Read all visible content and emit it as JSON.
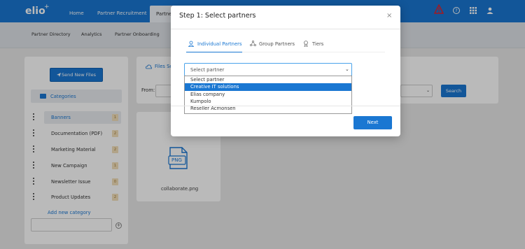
{
  "app": {
    "logo": "elio",
    "logo_plus": "+"
  },
  "top_nav": {
    "home": "Home",
    "partner_recruitment": "Partner Recruitment",
    "partner_active": "Partne"
  },
  "sub_nav": {
    "directory": "Partner Directory",
    "analytics": "Analytics",
    "onboarding": "Partner Onboarding"
  },
  "sidebar": {
    "send_button": "Send New Files",
    "categories_title": "Categories",
    "items": [
      {
        "label": "Banners",
        "count": "1"
      },
      {
        "label": "Documentation (PDF)",
        "count": "2"
      },
      {
        "label": "Marketing Material",
        "count": "2"
      },
      {
        "label": "New Campaign",
        "count": "1"
      },
      {
        "label": "Newsletter Issue",
        "count": "0"
      },
      {
        "label": "Product Updates",
        "count": "2"
      }
    ],
    "add_category": "Add new category"
  },
  "filter": {
    "files_tab": "Files Se",
    "from_label": "From:",
    "search_button": "Search"
  },
  "file": {
    "name": "collaborate.png",
    "icon_text": "PNG"
  },
  "modal": {
    "title": "Step 1: Select partners",
    "tabs": [
      {
        "label": "Individual Partners"
      },
      {
        "label": "Group Partners"
      },
      {
        "label": "Tiers"
      }
    ],
    "select_value": "Select partner",
    "options": [
      "Select partner",
      "Creative IT solutions",
      "Elias company",
      "Kumpolo",
      "Reseller Acmonsen"
    ],
    "highlighted_option_index": 1,
    "next_button": "Next"
  },
  "colors": {
    "accent": "#1a77d2",
    "badge_bg": "#f3e0bb",
    "warning": "#e0232e"
  }
}
